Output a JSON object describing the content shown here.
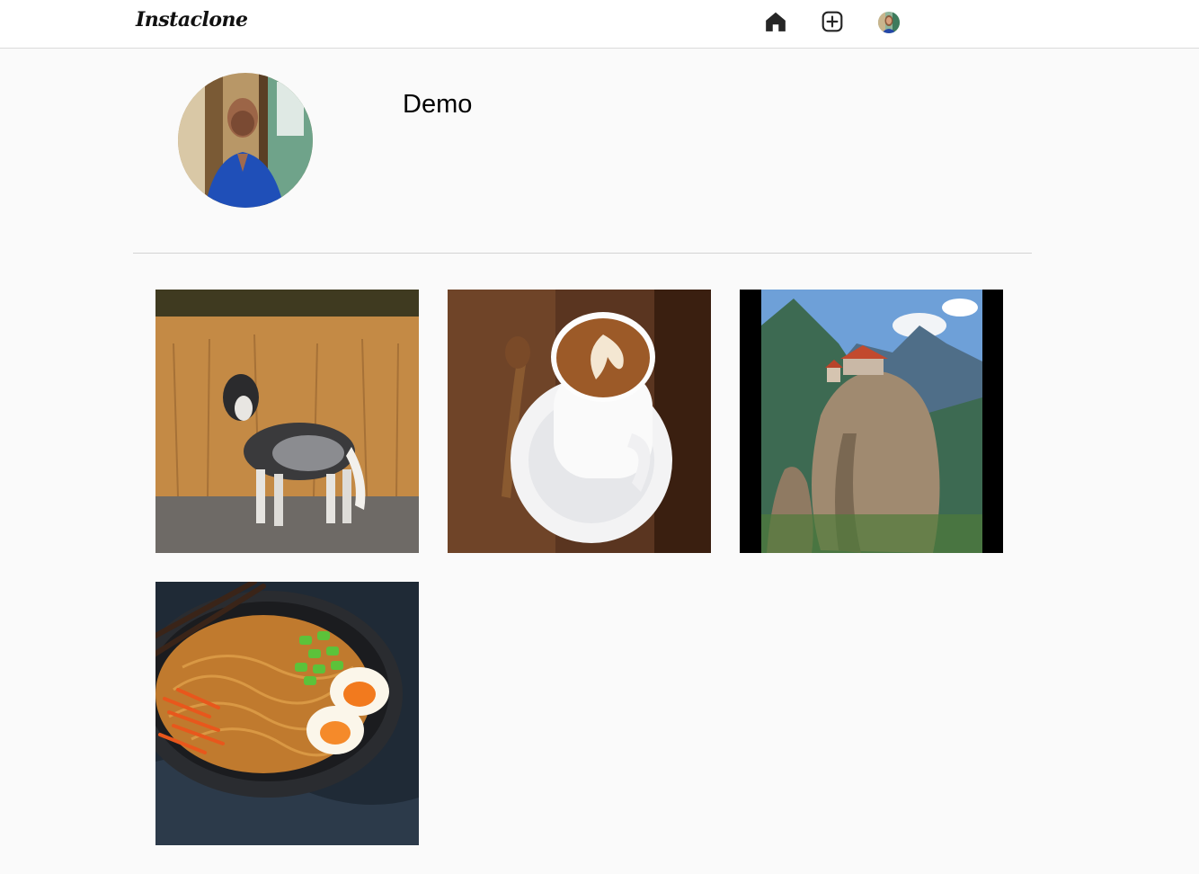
{
  "app": {
    "logo_text": "Instaclone"
  },
  "nav": {
    "items": [
      {
        "name": "home",
        "icon": "home-icon"
      },
      {
        "name": "create",
        "icon": "plus-square-icon"
      },
      {
        "name": "profile",
        "icon": "avatar-icon"
      }
    ]
  },
  "profile": {
    "username": "Demo"
  },
  "posts": [
    {
      "subject": "dog"
    },
    {
      "subject": "coffee"
    },
    {
      "subject": "mountain-monastery"
    },
    {
      "subject": "ramen"
    }
  ],
  "colors": {
    "background": "#fafafa",
    "topbar": "#ffffff",
    "border": "#dbdbdb",
    "icon": "#262626"
  }
}
